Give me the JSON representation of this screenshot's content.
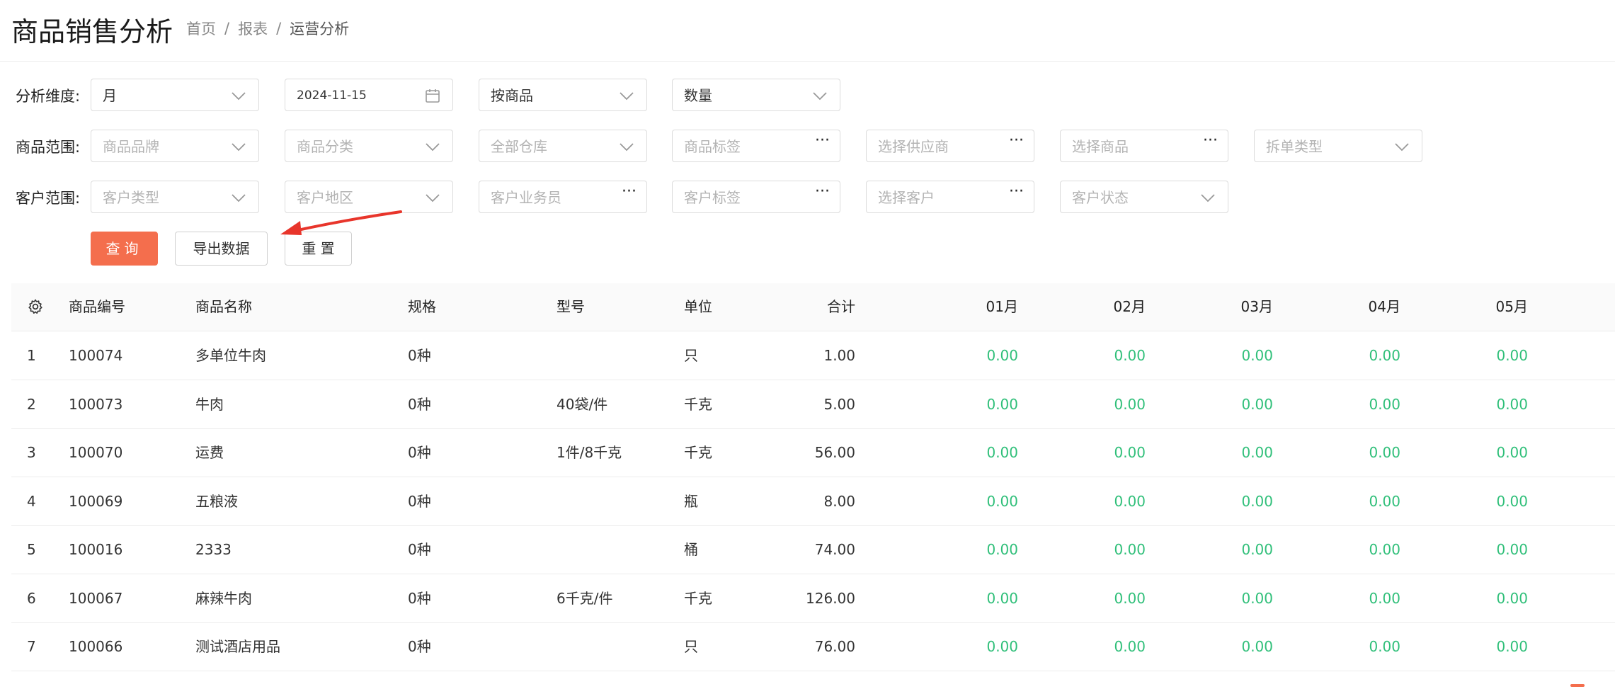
{
  "header": {
    "title": "商品销售分析",
    "breadcrumb": [
      "首页",
      "报表",
      "运营分析"
    ]
  },
  "filters": {
    "row1_label": "分析维度:",
    "row2_label": "商品范围:",
    "row3_label": "客户范围:",
    "dimension": "月",
    "date": "2024-11-15",
    "group_by": "按商品",
    "metric": "数量",
    "product_brand": "商品品牌",
    "product_category": "商品分类",
    "warehouse": "全部仓库",
    "product_tag": "商品标签",
    "supplier": "选择供应商",
    "product": "选择商品",
    "split_type": "拆单类型",
    "customer_type": "客户类型",
    "customer_region": "客户地区",
    "customer_salesman": "客户业务员",
    "customer_tag": "客户标签",
    "customer": "选择客户",
    "customer_status": "客户状态"
  },
  "actions": {
    "query": "查询",
    "export": "导出数据",
    "reset": "重 置"
  },
  "table": {
    "headers": {
      "code": "商品编号",
      "name": "商品名称",
      "spec": "规格",
      "model": "型号",
      "unit": "单位",
      "total": "合计",
      "m01": "01月",
      "m02": "02月",
      "m03": "03月",
      "m04": "04月",
      "m05": "05月"
    },
    "rows": [
      {
        "idx": "1",
        "code": "100074",
        "name": "多单位牛肉",
        "spec": "0种",
        "model": "",
        "unit": "只",
        "total": "1.00",
        "m01": "0.00",
        "m02": "0.00",
        "m03": "0.00",
        "m04": "0.00",
        "m05": "0.00"
      },
      {
        "idx": "2",
        "code": "100073",
        "name": "牛肉",
        "spec": "0种",
        "model": "40袋/件",
        "unit": "千克",
        "total": "5.00",
        "m01": "0.00",
        "m02": "0.00",
        "m03": "0.00",
        "m04": "0.00",
        "m05": "0.00"
      },
      {
        "idx": "3",
        "code": "100070",
        "name": "运费",
        "spec": "0种",
        "model": "1件/8千克",
        "unit": "千克",
        "total": "56.00",
        "m01": "0.00",
        "m02": "0.00",
        "m03": "0.00",
        "m04": "0.00",
        "m05": "0.00"
      },
      {
        "idx": "4",
        "code": "100069",
        "name": "五粮液",
        "spec": "0种",
        "model": "",
        "unit": "瓶",
        "total": "8.00",
        "m01": "0.00",
        "m02": "0.00",
        "m03": "0.00",
        "m04": "0.00",
        "m05": "0.00"
      },
      {
        "idx": "5",
        "code": "100016",
        "name": "2333",
        "spec": "0种",
        "model": "",
        "unit": "桶",
        "total": "74.00",
        "m01": "0.00",
        "m02": "0.00",
        "m03": "0.00",
        "m04": "0.00",
        "m05": "0.00"
      },
      {
        "idx": "6",
        "code": "100067",
        "name": "麻辣牛肉",
        "spec": "0种",
        "model": "6千克/件",
        "unit": "千克",
        "total": "126.00",
        "m01": "0.00",
        "m02": "0.00",
        "m03": "0.00",
        "m04": "0.00",
        "m05": "0.00"
      },
      {
        "idx": "7",
        "code": "100066",
        "name": "测试酒店用品",
        "spec": "0种",
        "model": "",
        "unit": "只",
        "total": "76.00",
        "m01": "0.00",
        "m02": "0.00",
        "m03": "0.00",
        "m04": "0.00",
        "m05": "0.00"
      }
    ]
  },
  "colors": {
    "accent": "#f46e4d",
    "value_green": "#2fbf79",
    "annotation_arrow": "#e8352b"
  },
  "icons": [
    "chevron-down-icon",
    "calendar-icon",
    "more-dots-icon",
    "gear-icon",
    "annotation-arrow"
  ]
}
